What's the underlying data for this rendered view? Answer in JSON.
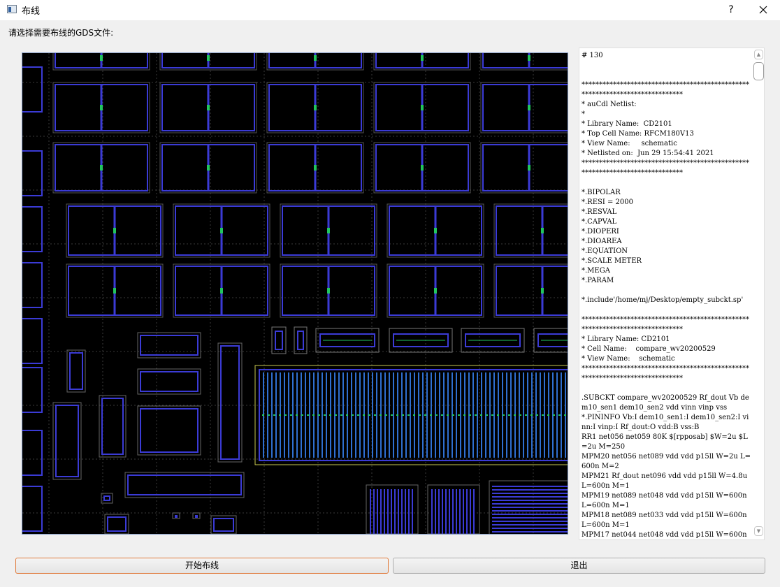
{
  "window": {
    "title": "布线",
    "help_label": "?",
    "icon": "app-window-icon",
    "close_icon": "close-icon"
  },
  "prompt": {
    "label": "请选择需要布线的GDS文件:"
  },
  "layout_view": {
    "background": "#000000",
    "shape_color": "#3b3bd6",
    "accent_color": "#22c55e"
  },
  "netlist": {
    "text": "# 130\n\n\n*****************************************************************************\n* auCdl Netlist:\n*\n* Library Name:  CD2101\n* Top Cell Name: RFCM180V13\n* View Name:     schematic\n* Netlisted on:  Jun 29 15:54:41 2021\n*****************************************************************************\n\n*.BIPOLAR\n*.RESI = 2000\n*.RESVAL\n*.CAPVAL\n*.DIOPERI\n*.DIOAREA\n*.EQUATION\n*.SCALE METER\n*.MEGA\n*.PARAM\n\n*.include'/home/mj/Desktop/empty_subckt.sp'\n\n*****************************************************************************\n* Library Name: CD2101\n* Cell Name:    compare_wv20200529\n* View Name:    schematic\n*****************************************************************************\n\n.SUBCKT compare_wv20200529 Rf_dout Vb dem10_sen1 dem10_sen2 vdd vinn vinp vss\n*.PININFO Vb:I dem10_sen1:I dem10_sen2:I vinn:I vinp:I Rf_dout:O vdd:B vss:B\nRR1 net056 net059 80K $[rpposab] $W=2u $L=2u M=250\nMPM20 net056 net089 vdd vdd p15ll W=2u L=600n M=2\nMPM21 Rf_dout net096 vdd vdd p15ll W=4.8u L=600n M=1\nMPM19 net089 net048 vdd vdd p15ll W=600n L=600n M=1\nMPM18 net089 net033 vdd vdd p15ll W=600n L=600n M=1\nMPM17 net044 net048 vdd vdd p15ll W=600n"
  },
  "buttons": {
    "start_label": "开始布线",
    "exit_label": "退出"
  },
  "colors": {
    "start_border": "#e07a3a",
    "window_bg": "#f0f0f0"
  }
}
